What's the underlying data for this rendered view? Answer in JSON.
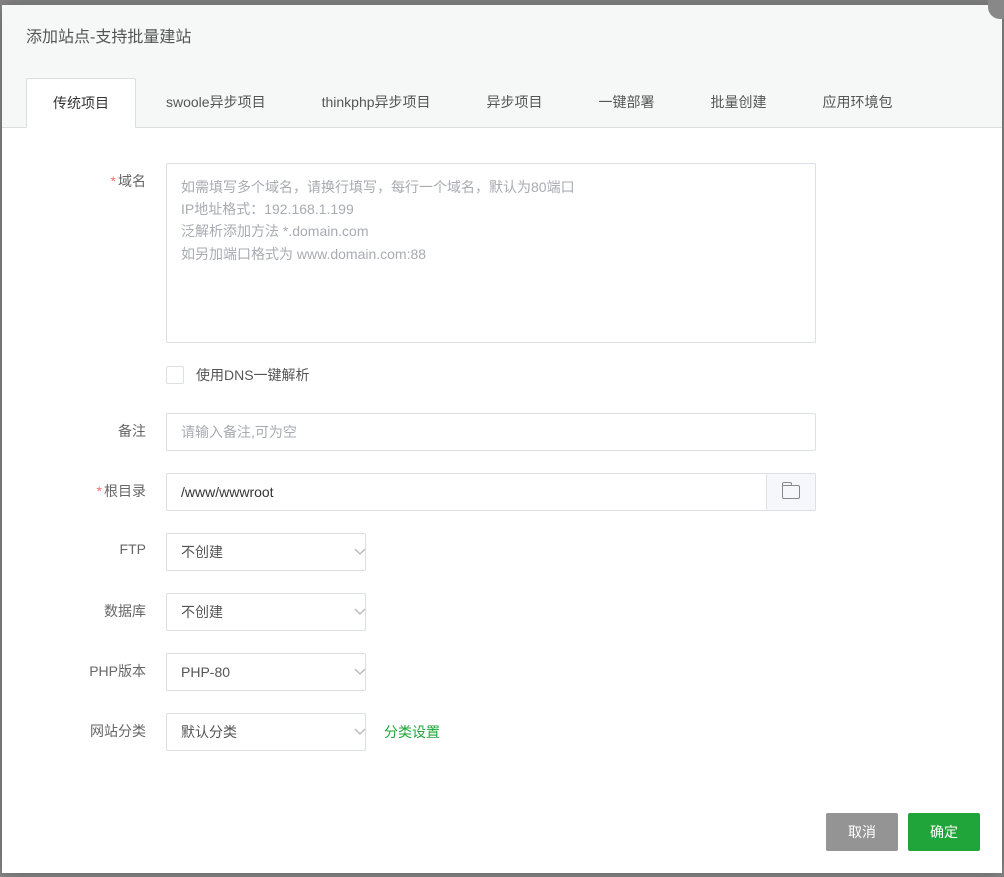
{
  "modal": {
    "title": "添加站点-支持批量建站"
  },
  "tabs": [
    {
      "label": "传统项目",
      "active": true
    },
    {
      "label": "swoole异步项目",
      "active": false
    },
    {
      "label": "thinkphp异步项目",
      "active": false
    },
    {
      "label": "异步项目",
      "active": false
    },
    {
      "label": "一键部署",
      "active": false
    },
    {
      "label": "批量创建",
      "active": false
    },
    {
      "label": "应用环境包",
      "active": false
    }
  ],
  "form": {
    "domain": {
      "label": "域名",
      "placeholder": "如需填写多个域名，请换行填写，每行一个域名，默认为80端口\nIP地址格式：192.168.1.199\n泛解析添加方法 *.domain.com\n如另加端口格式为 www.domain.com:88",
      "value": ""
    },
    "dns_checkbox": {
      "label": "使用DNS一键解析",
      "checked": false
    },
    "remark": {
      "label": "备注",
      "placeholder": "请输入备注,可为空",
      "value": ""
    },
    "root_dir": {
      "label": "根目录",
      "value": "/www/wwwroot"
    },
    "ftp": {
      "label": "FTP",
      "value": "不创建"
    },
    "database": {
      "label": "数据库",
      "value": "不创建"
    },
    "php_version": {
      "label": "PHP版本",
      "value": "PHP-80"
    },
    "category": {
      "label": "网站分类",
      "value": "默认分类",
      "settings_link": "分类设置"
    }
  },
  "footer": {
    "cancel": "取消",
    "confirm": "确定"
  }
}
